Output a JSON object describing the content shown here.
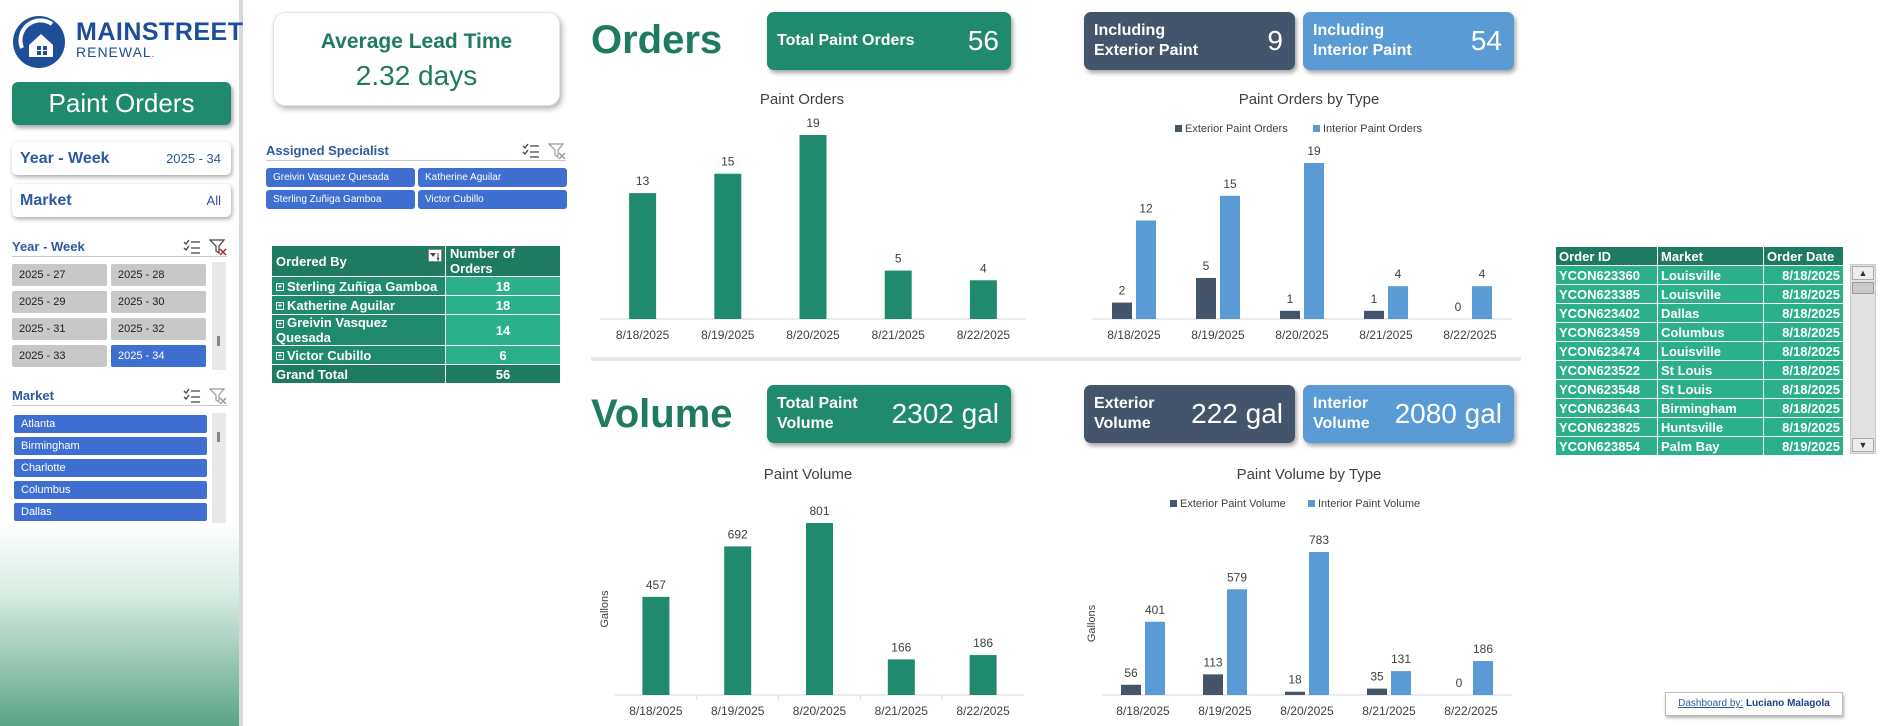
{
  "brand": {
    "line1": "MAINSTREET",
    "line2": "RENEWAL",
    "mark": "."
  },
  "sidebar": {
    "title": "Paint Orders",
    "year_week": {
      "label": "Year - Week",
      "value": "2025 - 34"
    },
    "market": {
      "label": "Market",
      "value": "All"
    },
    "year_week_slicer": {
      "title": "Year - Week",
      "items": [
        "2025 - 27",
        "2025 - 28",
        "2025 - 29",
        "2025 - 30",
        "2025 - 31",
        "2025 - 32",
        "2025 - 33",
        "2025 - 34"
      ],
      "selected": "2025 - 34"
    },
    "market_slicer": {
      "title": "Market",
      "items": [
        "Atlanta",
        "Birmingham",
        "Charlotte",
        "Columbus",
        "Dallas"
      ]
    }
  },
  "lead_time": {
    "title": "Average Lead Time",
    "value": "2.32 days"
  },
  "specialist": {
    "title": "Assigned Specialist",
    "items": [
      "Greivin Vasquez Quesada",
      "Katherine Aguilar",
      "Sterling Zuñiga Gamboa",
      "Victor Cubillo"
    ]
  },
  "pivot": {
    "headers": [
      "Ordered By",
      "Number of Orders"
    ],
    "rows": [
      {
        "name": "Sterling Zuñiga Gamboa",
        "count": "18"
      },
      {
        "name": "Katherine Aguilar",
        "count": "18"
      },
      {
        "name": "Greivin Vasquez Quesada",
        "count": "14"
      },
      {
        "name": "Victor Cubillo",
        "count": "6"
      }
    ],
    "total": {
      "name": "Grand Total",
      "count": "56"
    },
    "expand_glyph": "+"
  },
  "orders_section": {
    "title": "Orders",
    "kpis": {
      "total": {
        "label": "Total Paint Orders",
        "value": "56"
      },
      "exterior": {
        "label1": "Including",
        "label2": "Exterior Paint",
        "value": "9"
      },
      "interior": {
        "label1": "Including",
        "label2": "Interior Paint",
        "value": "54"
      }
    }
  },
  "volume_section": {
    "title": "Volume",
    "kpis": {
      "total": {
        "label1": "Total Paint",
        "label2": "Volume",
        "value": "2302 gal"
      },
      "exterior": {
        "label1": "Exterior",
        "label2": "Volume",
        "value": "222 gal"
      },
      "interior": {
        "label1": "Interior",
        "label2": "Volume",
        "value": "2080 gal"
      }
    }
  },
  "chart_data": [
    {
      "id": "paint_orders",
      "type": "bar",
      "title": "Paint Orders",
      "categories": [
        "8/18/2025",
        "8/19/2025",
        "8/20/2025",
        "8/21/2025",
        "8/22/2025"
      ],
      "series": [
        {
          "values": [
            13,
            15,
            19,
            5,
            4
          ]
        }
      ],
      "ylim": [
        0,
        19
      ],
      "colors": [
        "#1f8a6d"
      ],
      "legend": "none"
    },
    {
      "id": "paint_orders_by_type",
      "type": "bar",
      "title": "Paint Orders by Type",
      "categories": [
        "8/18/2025",
        "8/19/2025",
        "8/20/2025",
        "8/21/2025",
        "8/22/2025"
      ],
      "series": [
        {
          "name": "Exterior Paint Orders",
          "values": [
            2,
            5,
            1,
            1,
            0
          ]
        },
        {
          "name": "Interior Paint Orders",
          "values": [
            12,
            15,
            19,
            4,
            4
          ]
        }
      ],
      "ylim": [
        0,
        19
      ],
      "colors": [
        "#44546a",
        "#5b9bd5"
      ],
      "legend": "top"
    },
    {
      "id": "paint_volume",
      "type": "bar",
      "title": "Paint Volume",
      "ylabel": "Gallons",
      "categories": [
        "8/18/2025",
        "8/19/2025",
        "8/20/2025",
        "8/21/2025",
        "8/22/2025"
      ],
      "series": [
        {
          "values": [
            457,
            692,
            801,
            166,
            186
          ]
        }
      ],
      "ylim": [
        0,
        801
      ],
      "colors": [
        "#1f8a6d"
      ],
      "legend": "none"
    },
    {
      "id": "paint_volume_by_type",
      "type": "bar",
      "title": "Paint Volume by Type",
      "ylabel": "Gallons",
      "categories": [
        "8/18/2025",
        "8/19/2025",
        "8/20/2025",
        "8/21/2025",
        "8/22/2025"
      ],
      "series": [
        {
          "name": "Exterior Paint Volume",
          "values": [
            56,
            113,
            18,
            35,
            0
          ]
        },
        {
          "name": "Interior Paint Volume",
          "values": [
            401,
            579,
            783,
            131,
            186
          ]
        }
      ],
      "ylim": [
        0,
        783
      ],
      "colors": [
        "#44546a",
        "#5b9bd5"
      ],
      "legend": "top"
    }
  ],
  "order_list": {
    "headers": [
      "Order ID",
      "Market",
      "Order Date"
    ],
    "rows": [
      [
        "YCON623360",
        "Louisville",
        "8/18/2025"
      ],
      [
        "YCON623385",
        "Louisville",
        "8/18/2025"
      ],
      [
        "YCON623402",
        "Dallas",
        "8/18/2025"
      ],
      [
        "YCON623459",
        "Columbus",
        "8/18/2025"
      ],
      [
        "YCON623474",
        "Louisville",
        "8/18/2025"
      ],
      [
        "YCON623522",
        "St Louis",
        "8/18/2025"
      ],
      [
        "YCON623548",
        "St Louis",
        "8/18/2025"
      ],
      [
        "YCON623643",
        "Birmingham",
        "8/18/2025"
      ],
      [
        "YCON623825",
        "Huntsville",
        "8/19/2025"
      ],
      [
        "YCON623854",
        "Palm Bay",
        "8/19/2025"
      ]
    ]
  },
  "credit": {
    "prefix": "Dashboard by:",
    "author": "Luciano Malagola"
  },
  "icons": {
    "multi_select": "multi-select-icon",
    "clear_filter": "clear-filter-icon",
    "scroll_up": "scroll-up-icon",
    "scroll_down": "scroll-down-icon",
    "logo": "house-logo-icon"
  },
  "colors": {
    "green": "#1f8a6d",
    "green_dark": "#1f7a62",
    "green_light": "#2bb08b",
    "slate": "#44546a",
    "blue": "#5b9bd5",
    "slicer_blue": "#3f6fd0"
  }
}
